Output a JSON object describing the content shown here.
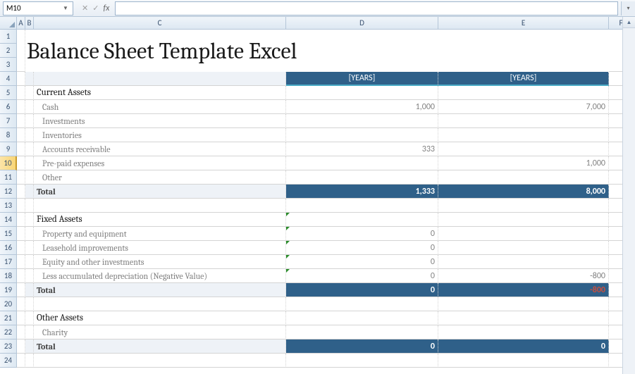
{
  "formula_bar": {
    "cell_ref": "M10",
    "fx_label": "fx",
    "formula": ""
  },
  "columns": [
    "A",
    "B",
    "C",
    "D",
    "E",
    "F"
  ],
  "selected_row": 10,
  "title": "Balance Sheet Template Excel",
  "year_header": "[YEARS]",
  "sections": {
    "current_assets": {
      "header": "Current Assets",
      "items": [
        {
          "label": "Cash",
          "d": "1,000",
          "e": "7,000"
        },
        {
          "label": "Investments",
          "d": "",
          "e": ""
        },
        {
          "label": "Inventories",
          "d": "",
          "e": ""
        },
        {
          "label": "Accounts receivable",
          "d": "333",
          "e": ""
        },
        {
          "label": "Pre-paid expenses",
          "d": "",
          "e": "1,000"
        },
        {
          "label": "Other",
          "d": "",
          "e": ""
        }
      ],
      "total": {
        "label": "Total",
        "d": "1,333",
        "e": "8,000"
      }
    },
    "fixed_assets": {
      "header": "Fixed Assets",
      "items": [
        {
          "label": "Property and equipment",
          "d": "0",
          "e": ""
        },
        {
          "label": "Leasehold improvements",
          "d": "0",
          "e": ""
        },
        {
          "label": "Equity and other investments",
          "d": "0",
          "e": ""
        },
        {
          "label": "Less accumulated depreciation (Negative Value)",
          "d": "0",
          "e": "-800"
        }
      ],
      "total": {
        "label": "Total",
        "d": "0",
        "e": "-800"
      }
    },
    "other_assets": {
      "header": "Other Assets",
      "items": [
        {
          "label": "Charity",
          "d": "",
          "e": ""
        }
      ],
      "total": {
        "label": "Total",
        "d": "0",
        "e": "0"
      }
    }
  }
}
